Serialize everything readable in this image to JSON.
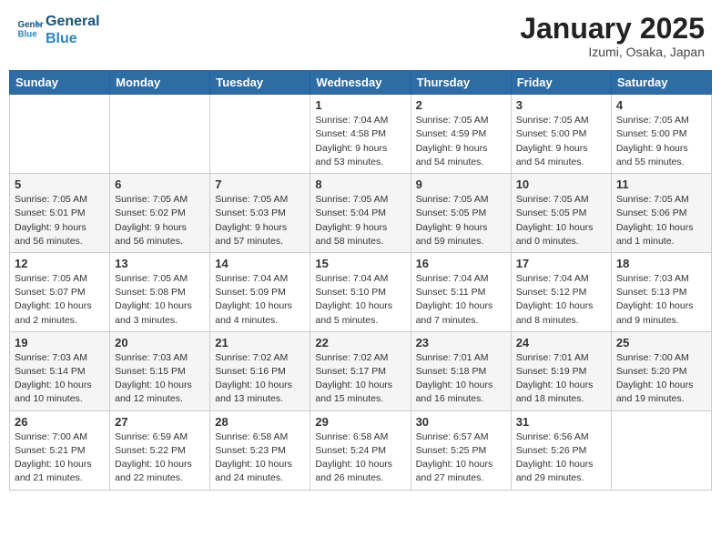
{
  "header": {
    "logo_line1": "General",
    "logo_line2": "Blue",
    "month_title": "January 2025",
    "location": "Izumi, Osaka, Japan"
  },
  "weekdays": [
    "Sunday",
    "Monday",
    "Tuesday",
    "Wednesday",
    "Thursday",
    "Friday",
    "Saturday"
  ],
  "weeks": [
    [
      {
        "day": "",
        "info": ""
      },
      {
        "day": "",
        "info": ""
      },
      {
        "day": "",
        "info": ""
      },
      {
        "day": "1",
        "info": "Sunrise: 7:04 AM\nSunset: 4:58 PM\nDaylight: 9 hours\nand 53 minutes."
      },
      {
        "day": "2",
        "info": "Sunrise: 7:05 AM\nSunset: 4:59 PM\nDaylight: 9 hours\nand 54 minutes."
      },
      {
        "day": "3",
        "info": "Sunrise: 7:05 AM\nSunset: 5:00 PM\nDaylight: 9 hours\nand 54 minutes."
      },
      {
        "day": "4",
        "info": "Sunrise: 7:05 AM\nSunset: 5:00 PM\nDaylight: 9 hours\nand 55 minutes."
      }
    ],
    [
      {
        "day": "5",
        "info": "Sunrise: 7:05 AM\nSunset: 5:01 PM\nDaylight: 9 hours\nand 56 minutes."
      },
      {
        "day": "6",
        "info": "Sunrise: 7:05 AM\nSunset: 5:02 PM\nDaylight: 9 hours\nand 56 minutes."
      },
      {
        "day": "7",
        "info": "Sunrise: 7:05 AM\nSunset: 5:03 PM\nDaylight: 9 hours\nand 57 minutes."
      },
      {
        "day": "8",
        "info": "Sunrise: 7:05 AM\nSunset: 5:04 PM\nDaylight: 9 hours\nand 58 minutes."
      },
      {
        "day": "9",
        "info": "Sunrise: 7:05 AM\nSunset: 5:05 PM\nDaylight: 9 hours\nand 59 minutes."
      },
      {
        "day": "10",
        "info": "Sunrise: 7:05 AM\nSunset: 5:05 PM\nDaylight: 10 hours\nand 0 minutes."
      },
      {
        "day": "11",
        "info": "Sunrise: 7:05 AM\nSunset: 5:06 PM\nDaylight: 10 hours\nand 1 minute."
      }
    ],
    [
      {
        "day": "12",
        "info": "Sunrise: 7:05 AM\nSunset: 5:07 PM\nDaylight: 10 hours\nand 2 minutes."
      },
      {
        "day": "13",
        "info": "Sunrise: 7:05 AM\nSunset: 5:08 PM\nDaylight: 10 hours\nand 3 minutes."
      },
      {
        "day": "14",
        "info": "Sunrise: 7:04 AM\nSunset: 5:09 PM\nDaylight: 10 hours\nand 4 minutes."
      },
      {
        "day": "15",
        "info": "Sunrise: 7:04 AM\nSunset: 5:10 PM\nDaylight: 10 hours\nand 5 minutes."
      },
      {
        "day": "16",
        "info": "Sunrise: 7:04 AM\nSunset: 5:11 PM\nDaylight: 10 hours\nand 7 minutes."
      },
      {
        "day": "17",
        "info": "Sunrise: 7:04 AM\nSunset: 5:12 PM\nDaylight: 10 hours\nand 8 minutes."
      },
      {
        "day": "18",
        "info": "Sunrise: 7:03 AM\nSunset: 5:13 PM\nDaylight: 10 hours\nand 9 minutes."
      }
    ],
    [
      {
        "day": "19",
        "info": "Sunrise: 7:03 AM\nSunset: 5:14 PM\nDaylight: 10 hours\nand 10 minutes."
      },
      {
        "day": "20",
        "info": "Sunrise: 7:03 AM\nSunset: 5:15 PM\nDaylight: 10 hours\nand 12 minutes."
      },
      {
        "day": "21",
        "info": "Sunrise: 7:02 AM\nSunset: 5:16 PM\nDaylight: 10 hours\nand 13 minutes."
      },
      {
        "day": "22",
        "info": "Sunrise: 7:02 AM\nSunset: 5:17 PM\nDaylight: 10 hours\nand 15 minutes."
      },
      {
        "day": "23",
        "info": "Sunrise: 7:01 AM\nSunset: 5:18 PM\nDaylight: 10 hours\nand 16 minutes."
      },
      {
        "day": "24",
        "info": "Sunrise: 7:01 AM\nSunset: 5:19 PM\nDaylight: 10 hours\nand 18 minutes."
      },
      {
        "day": "25",
        "info": "Sunrise: 7:00 AM\nSunset: 5:20 PM\nDaylight: 10 hours\nand 19 minutes."
      }
    ],
    [
      {
        "day": "26",
        "info": "Sunrise: 7:00 AM\nSunset: 5:21 PM\nDaylight: 10 hours\nand 21 minutes."
      },
      {
        "day": "27",
        "info": "Sunrise: 6:59 AM\nSunset: 5:22 PM\nDaylight: 10 hours\nand 22 minutes."
      },
      {
        "day": "28",
        "info": "Sunrise: 6:58 AM\nSunset: 5:23 PM\nDaylight: 10 hours\nand 24 minutes."
      },
      {
        "day": "29",
        "info": "Sunrise: 6:58 AM\nSunset: 5:24 PM\nDaylight: 10 hours\nand 26 minutes."
      },
      {
        "day": "30",
        "info": "Sunrise: 6:57 AM\nSunset: 5:25 PM\nDaylight: 10 hours\nand 27 minutes."
      },
      {
        "day": "31",
        "info": "Sunrise: 6:56 AM\nSunset: 5:26 PM\nDaylight: 10 hours\nand 29 minutes."
      },
      {
        "day": "",
        "info": ""
      }
    ]
  ]
}
